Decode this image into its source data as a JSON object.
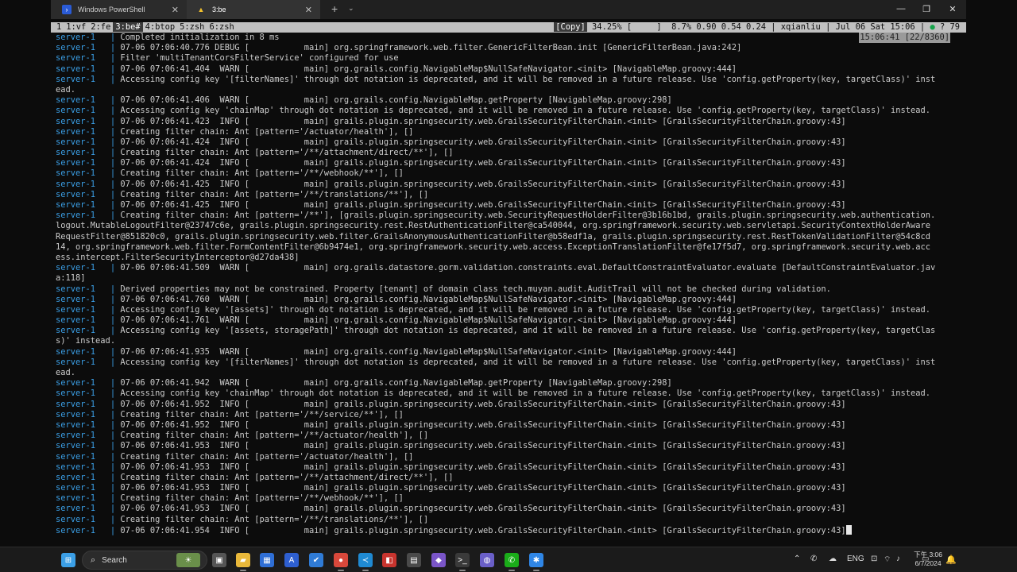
{
  "window": {
    "tabs": [
      {
        "label": "Windows PowerShell",
        "close": "✕"
      },
      {
        "label": "3:be",
        "close": "✕"
      }
    ],
    "new_tab": "+",
    "dropdown": "⌄",
    "controls": {
      "minimize": "—",
      "maximize": "❐",
      "close": "✕"
    }
  },
  "statusbar": {
    "windows": [
      {
        "label": "1"
      },
      {
        "label": "1:vf"
      },
      {
        "label": "2:fe"
      },
      {
        "label": "3:be#",
        "active": true
      },
      {
        "label": "4:btop"
      },
      {
        "label": "5:zsh"
      },
      {
        "label": "6:zsh"
      }
    ],
    "copy": "[Copy]",
    "right": " 34.25% [     ]  8.7% 0.90 0.54 0.24 | xqianliu | Jul 06 Sat 15:06 | ",
    "dot": "●",
    "tail": " ? 79",
    "timestamp": "15:06:41 [22/8360]"
  },
  "terminal": {
    "prefix": "server-1   | ",
    "lines": [
      "Completed initialization in 8 ms",
      "07-06 07:06:40.776 DEBUG [           main] org.springframework.web.filter.GenericFilterBean.init [GenericFilterBean.java:242]",
      "Filter 'multiTenantCorsFilterService' configured for use",
      "07-06 07:06:41.404  WARN [           main] org.grails.config.NavigableMap$NullSafeNavigator.<init> [NavigableMap.groovy:444]",
      "Accessing config key '[filterNames]' through dot notation is deprecated, and it will be removed in a future release. Use 'config.getProperty(key, targetClass)' inst",
      "@ead.",
      "07-06 07:06:41.406  WARN [           main] org.grails.config.NavigableMap.getProperty [NavigableMap.groovy:298]",
      "Accessing config key 'chainMap' through dot notation is deprecated, and it will be removed in a future release. Use 'config.getProperty(key, targetClass)' instead.",
      "07-06 07:06:41.423  INFO [           main] grails.plugin.springsecurity.web.GrailsSecurityFilterChain.<init> [GrailsSecurityFilterChain.groovy:43]",
      "Creating filter chain: Ant [pattern='/actuator/health'], []",
      "07-06 07:06:41.424  INFO [           main] grails.plugin.springsecurity.web.GrailsSecurityFilterChain.<init> [GrailsSecurityFilterChain.groovy:43]",
      "Creating filter chain: Ant [pattern='/**/attachment/direct/**'], []",
      "07-06 07:06:41.424  INFO [           main] grails.plugin.springsecurity.web.GrailsSecurityFilterChain.<init> [GrailsSecurityFilterChain.groovy:43]",
      "Creating filter chain: Ant [pattern='/**/webhook/**'], []",
      "07-06 07:06:41.425  INFO [           main] grails.plugin.springsecurity.web.GrailsSecurityFilterChain.<init> [GrailsSecurityFilterChain.groovy:43]",
      "Creating filter chain: Ant [pattern='/**/translations/**'], []",
      "07-06 07:06:41.425  INFO [           main] grails.plugin.springsecurity.web.GrailsSecurityFilterChain.<init> [GrailsSecurityFilterChain.groovy:43]",
      "Creating filter chain: Ant [pattern='/**'], [grails.plugin.springsecurity.web.SecurityRequestHolderFilter@3b16b1bd, grails.plugin.springsecurity.web.authentication.",
      "@logout.MutableLogoutFilter@23747c6e, grails.plugin.springsecurity.rest.RestAuthenticationFilter@ca540044, org.springframework.security.web.servletapi.SecurityContextHolderAware",
      "@RequestFilter@851820c0, grails.plugin.springsecurity.web.filter.GrailsAnonymousAuthenticationFilter@b58edf1a, grails.plugin.springsecurity.rest.RestTokenValidationFilter@54c8cd",
      "@14, org.springframework.web.filter.FormContentFilter@6b9474e1, org.springframework.security.web.access.ExceptionTranslationFilter@fe17f5d7, org.springframework.security.web.acc",
      "@ess.intercept.FilterSecurityInterceptor@d27da438]",
      "07-06 07:06:41.509  WARN [           main] org.grails.datastore.gorm.validation.constraints.eval.DefaultConstraintEvaluator.evaluate [DefaultConstraintEvaluator.jav",
      "@a:118]",
      "Derived properties may not be constrained. Property [tenant] of domain class tech.muyan.audit.AuditTrail will not be checked during validation.",
      "07-06 07:06:41.760  WARN [           main] org.grails.config.NavigableMap$NullSafeNavigator.<init> [NavigableMap.groovy:444]",
      "Accessing config key '[assets]' through dot notation is deprecated, and it will be removed in a future release. Use 'config.getProperty(key, targetClass)' instead.",
      "07-06 07:06:41.761  WARN [           main] org.grails.config.NavigableMap$NullSafeNavigator.<init> [NavigableMap.groovy:444]",
      "Accessing config key '[assets, storagePath]' through dot notation is deprecated, and it will be removed in a future release. Use 'config.getProperty(key, targetClas",
      "@s)' instead.",
      "07-06 07:06:41.935  WARN [           main] org.grails.config.NavigableMap$NullSafeNavigator.<init> [NavigableMap.groovy:444]",
      "Accessing config key '[filterNames]' through dot notation is deprecated, and it will be removed in a future release. Use 'config.getProperty(key, targetClass)' inst",
      "@ead.",
      "07-06 07:06:41.942  WARN [           main] org.grails.config.NavigableMap.getProperty [NavigableMap.groovy:298]",
      "Accessing config key 'chainMap' through dot notation is deprecated, and it will be removed in a future release. Use 'config.getProperty(key, targetClass)' instead.",
      "07-06 07:06:41.952  INFO [           main] grails.plugin.springsecurity.web.GrailsSecurityFilterChain.<init> [GrailsSecurityFilterChain.groovy:43]",
      "Creating filter chain: Ant [pattern='/**/service/**'], []",
      "07-06 07:06:41.952  INFO [           main] grails.plugin.springsecurity.web.GrailsSecurityFilterChain.<init> [GrailsSecurityFilterChain.groovy:43]",
      "Creating filter chain: Ant [pattern='/**/actuator/health'], []",
      "07-06 07:06:41.953  INFO [           main] grails.plugin.springsecurity.web.GrailsSecurityFilterChain.<init> [GrailsSecurityFilterChain.groovy:43]",
      "Creating filter chain: Ant [pattern='/actuator/health'], []",
      "07-06 07:06:41.953  INFO [           main] grails.plugin.springsecurity.web.GrailsSecurityFilterChain.<init> [GrailsSecurityFilterChain.groovy:43]",
      "Creating filter chain: Ant [pattern='/**/attachment/direct/**'], []",
      "07-06 07:06:41.953  INFO [           main] grails.plugin.springsecurity.web.GrailsSecurityFilterChain.<init> [GrailsSecurityFilterChain.groovy:43]",
      "Creating filter chain: Ant [pattern='/**/webhook/**'], []",
      "07-06 07:06:41.953  INFO [           main] grails.plugin.springsecurity.web.GrailsSecurityFilterChain.<init> [GrailsSecurityFilterChain.groovy:43]",
      "Creating filter chain: Ant [pattern='/**/translations/**'], []",
      "07-06 07:06:41.954  INFO [           main] grails.plugin.springsecurity.web.GrailsSecurityFilterChain.<init> [GrailsSecurityFilterChain.groovy:43]"
    ]
  },
  "taskbar": {
    "search_placeholder": "Search",
    "search_icon": "search-icon",
    "apps": [
      {
        "name": "start",
        "glyph": "⊞",
        "color": "#3b9fe6"
      },
      {
        "name": "widgets",
        "glyph": "☀",
        "color": "#6a8f4a"
      },
      {
        "name": "task-view",
        "glyph": "▣",
        "color": "#555555"
      },
      {
        "name": "file-explorer",
        "glyph": "▰",
        "color": "#e9b83a"
      },
      {
        "name": "store",
        "glyph": "▦",
        "color": "#2f6fd6"
      },
      {
        "name": "editor",
        "glyph": "A",
        "color": "#2e5fd0"
      },
      {
        "name": "todo",
        "glyph": "✔",
        "color": "#2f7bd6"
      },
      {
        "name": "chrome",
        "glyph": "●",
        "color": "#d9483b"
      },
      {
        "name": "vscode",
        "glyph": "≺",
        "color": "#1f8ad2"
      },
      {
        "name": "app-red",
        "glyph": "◧",
        "color": "#c8342e"
      },
      {
        "name": "app-grid",
        "glyph": "▤",
        "color": "#4a4a4a"
      },
      {
        "name": "app-purple",
        "glyph": "◆",
        "color": "#7a55c8"
      },
      {
        "name": "terminal",
        "glyph": ">_",
        "color": "#3a3a3a"
      },
      {
        "name": "app-browser",
        "glyph": "◍",
        "color": "#6a5fc8"
      },
      {
        "name": "wechat",
        "glyph": "✆",
        "color": "#1aad19"
      },
      {
        "name": "app-settings",
        "glyph": "✱",
        "color": "#2f86e6"
      }
    ],
    "tray": {
      "chevron": "⌃",
      "lang": "ENG",
      "icons": [
        "✆",
        "☁",
        "◉",
        "⊡",
        "⌔",
        "♪",
        "▭"
      ],
      "time": "下午 3:06",
      "date": "6/7/2024",
      "bell": "🔔"
    }
  }
}
